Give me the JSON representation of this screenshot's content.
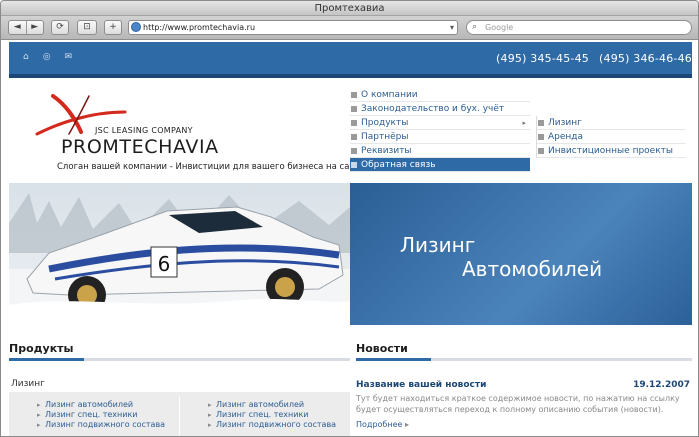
{
  "window": {
    "title": "Промтехавиа"
  },
  "browser": {
    "back": "◄",
    "forward": "►",
    "reload": "⟳",
    "screenshot": "⊡",
    "add": "+",
    "url": "http://www.promtechavia.ru",
    "search_placeholder": "Google"
  },
  "topbar": {
    "icons": [
      "home-icon",
      "sitemap-icon",
      "mail-icon"
    ],
    "phone1": "(495) 345-45-45",
    "phone2": "(495) 346-46-46"
  },
  "logo": {
    "small": "JSC LEASING COMPANY",
    "big": "PROMTECHAVIA"
  },
  "slogan": "Слоган вашей компании - Инвистиции для вашего бизнеса на са...",
  "menu": {
    "items": [
      {
        "label": "О компании"
      },
      {
        "label": "Законодательство и бух. учёт"
      },
      {
        "label": "Продукты",
        "arrow": "▸"
      },
      {
        "label": "Партнёры"
      },
      {
        "label": "Реквизиты"
      },
      {
        "label": "Обратная связь"
      }
    ],
    "submenu": [
      {
        "label": "Лизинг"
      },
      {
        "label": "Аренда"
      },
      {
        "label": "Инвистиционные проекты"
      }
    ]
  },
  "hero": {
    "line1": "Лизинг",
    "line2": "Автомобилей",
    "car_number": "6"
  },
  "products": {
    "title": "Продукты",
    "subtitle": "Лизинг",
    "col1": [
      "Лизинг автомобилей",
      "Лизинг спец. техники",
      "Лизинг подвижного состава"
    ],
    "col2": [
      "Лизинг автомобилей",
      "Лизинг спец. техники",
      "Лизинг подвижного состава"
    ]
  },
  "news": {
    "title": "Новости",
    "item_title": "Название вашей новости",
    "item_date": "19.12.2007",
    "item_text": "Тут будет находиться краткое содержимое новости, по нажатию на ссылку будет осуществляться переход к полному описанию события (новости).",
    "more": "Подробнее",
    "more_arrow": "▸"
  },
  "colors": {
    "brand_blue": "#2e6aa6",
    "dark_blue": "#1c4676",
    "logo_red": "#d42a1e"
  }
}
